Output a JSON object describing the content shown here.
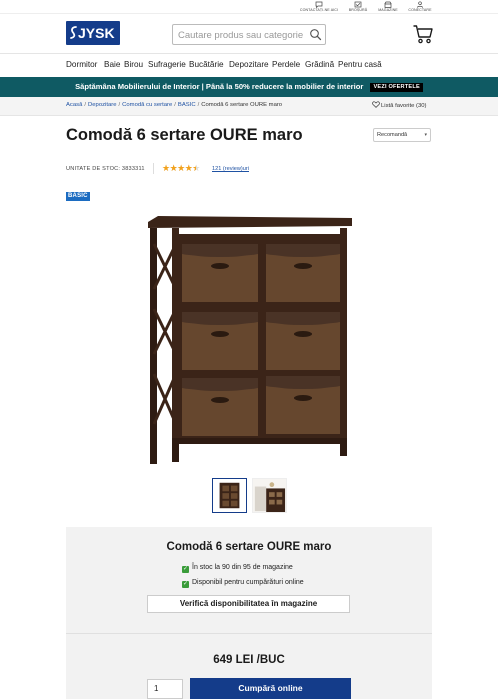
{
  "utility": {
    "contact": "CONTACTAȚI-NE AICI",
    "brochure": "BROȘURĂ",
    "stores": "MAGAZINE",
    "login": "CONECTARE"
  },
  "header": {
    "logo_text": "JYSK",
    "search_placeholder": "Cautare produs sau categorie...",
    "icons": [
      "search-icon",
      "cart-icon"
    ]
  },
  "nav": {
    "items": [
      "Dormitor",
      "Baie",
      "Birou",
      "Sufragerie",
      "Bucătărie",
      "Depozitare",
      "Perdele",
      "Grădină",
      "Pentru casă"
    ]
  },
  "promo": {
    "text": "Săptămâna Mobilierului de Interior | Până la 50% reducere la mobilier de interior",
    "button": "VEZI OFERTELE"
  },
  "breadcrumb": {
    "items": [
      "Acasă",
      "Depozitare",
      "Comodă cu sertare",
      "BASIC",
      "Comodă 6 sertare OURE maro"
    ],
    "favorites": "Listă favorite (30)"
  },
  "product": {
    "title": "Comodă 6 sertare OURE maro",
    "sku_label": "UNITATE DE STOC: 3833311",
    "rating": 4.5,
    "rating_display": "★★★★★",
    "reviews": "121 (review)uri",
    "badge": "BASIC",
    "sort_label": "Recomandă"
  },
  "availability": {
    "title": "Comodă 6 sertare OURE maro",
    "in_stock": "În stoc la 90 din 95 de magazine",
    "online": "Disponibil pentru cumpărături online",
    "verify_button": "Verifică disponibilitatea în magazine",
    "price": "649 LEI /BUC",
    "quantity": "1",
    "buy_button": "Cumpără online"
  },
  "colors": {
    "brand_blue": "#143c8a",
    "promo_teal": "#0f5a63",
    "check_green": "#3a9c3a",
    "star_orange": "#f3a21c",
    "wood_dark": "#3b2418"
  }
}
